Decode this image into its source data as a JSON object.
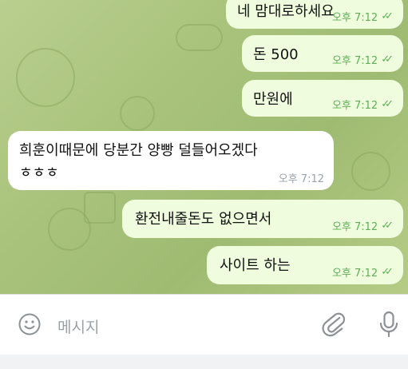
{
  "messages": [
    {
      "text": "네 맘대로하세요",
      "time": "오후 7:12",
      "direction": "out"
    },
    {
      "text": "돈 500",
      "time": "오후 7:12",
      "direction": "out"
    },
    {
      "text": "만원에",
      "time": "오후 7:12",
      "direction": "out"
    },
    {
      "text_line1": "희훈이때문에 당분간 양빵 덜들어오겠다",
      "text_line2": "ㅎㅎㅎ",
      "time": "오후 7:12",
      "direction": "in"
    },
    {
      "text": "환전내줄돈도 없으면서",
      "time": "오후 7:12",
      "direction": "out"
    },
    {
      "text": "사이트 하는",
      "time": "오후 7:12",
      "direction": "out"
    }
  ],
  "read_mark": "✓✓",
  "input": {
    "placeholder": "메시지"
  },
  "icons": {
    "emoji": "smile-icon",
    "attach": "paperclip-icon",
    "mic": "microphone-icon"
  },
  "colors": {
    "outgoing_bubble": "#effdde",
    "incoming_bubble": "#ffffff",
    "time_green": "#5fae56",
    "wallpaper": "#a9c37c"
  }
}
